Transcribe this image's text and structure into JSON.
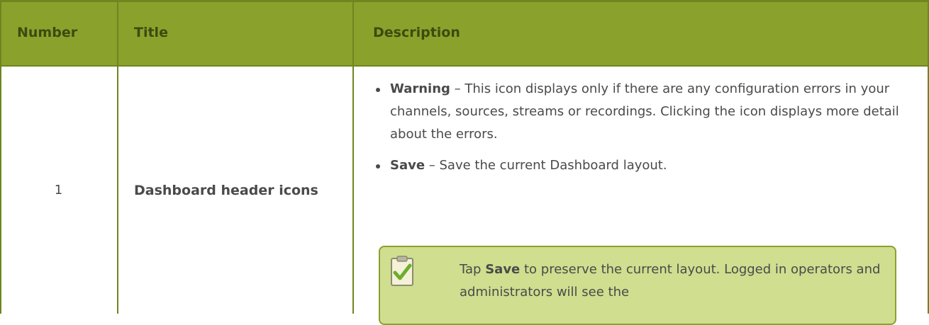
{
  "table": {
    "headers": {
      "number": "Number",
      "title": "Title",
      "description": "Description"
    },
    "row": {
      "number": "1",
      "title": "Dashboard header icons",
      "bullets": [
        {
          "term": "Warning",
          "text": " – This icon displays only if there are any configuration errors in your channels, sources, streams or recordings. Clicking the icon displays more detail about the errors."
        },
        {
          "term": "Save",
          "text": " – Save the current Dashboard layout."
        }
      ],
      "note": {
        "icon": "checklist-note-icon",
        "pre": "Tap ",
        "bold": "Save",
        "post": " to preserve the current layout. Logged in operators and administrators will see the"
      }
    }
  },
  "colors": {
    "header_bg": "#8aa22c",
    "header_text": "#3c4b0f",
    "note_bg": "#cfde8f",
    "border": "#6f8520"
  }
}
